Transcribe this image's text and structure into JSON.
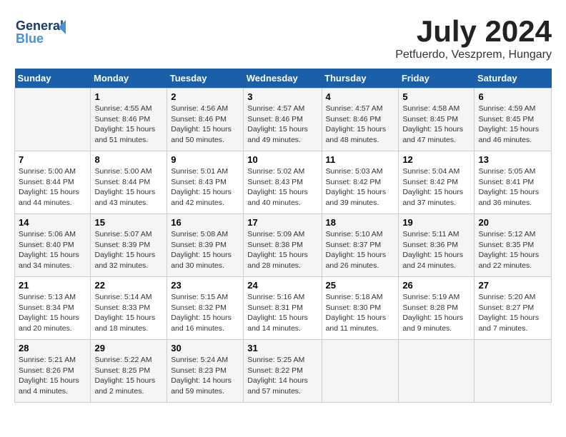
{
  "header": {
    "logo_line1": "General",
    "logo_line2": "Blue",
    "title": "July 2024",
    "location": "Petfuerdo, Veszprem, Hungary"
  },
  "calendar": {
    "days_of_week": [
      "Sunday",
      "Monday",
      "Tuesday",
      "Wednesday",
      "Thursday",
      "Friday",
      "Saturday"
    ],
    "weeks": [
      [
        {
          "day": "",
          "content": ""
        },
        {
          "day": "1",
          "content": "Sunrise: 4:55 AM\nSunset: 8:46 PM\nDaylight: 15 hours\nand 51 minutes."
        },
        {
          "day": "2",
          "content": "Sunrise: 4:56 AM\nSunset: 8:46 PM\nDaylight: 15 hours\nand 50 minutes."
        },
        {
          "day": "3",
          "content": "Sunrise: 4:57 AM\nSunset: 8:46 PM\nDaylight: 15 hours\nand 49 minutes."
        },
        {
          "day": "4",
          "content": "Sunrise: 4:57 AM\nSunset: 8:46 PM\nDaylight: 15 hours\nand 48 minutes."
        },
        {
          "day": "5",
          "content": "Sunrise: 4:58 AM\nSunset: 8:45 PM\nDaylight: 15 hours\nand 47 minutes."
        },
        {
          "day": "6",
          "content": "Sunrise: 4:59 AM\nSunset: 8:45 PM\nDaylight: 15 hours\nand 46 minutes."
        }
      ],
      [
        {
          "day": "7",
          "content": "Sunrise: 5:00 AM\nSunset: 8:44 PM\nDaylight: 15 hours\nand 44 minutes."
        },
        {
          "day": "8",
          "content": "Sunrise: 5:00 AM\nSunset: 8:44 PM\nDaylight: 15 hours\nand 43 minutes."
        },
        {
          "day": "9",
          "content": "Sunrise: 5:01 AM\nSunset: 8:43 PM\nDaylight: 15 hours\nand 42 minutes."
        },
        {
          "day": "10",
          "content": "Sunrise: 5:02 AM\nSunset: 8:43 PM\nDaylight: 15 hours\nand 40 minutes."
        },
        {
          "day": "11",
          "content": "Sunrise: 5:03 AM\nSunset: 8:42 PM\nDaylight: 15 hours\nand 39 minutes."
        },
        {
          "day": "12",
          "content": "Sunrise: 5:04 AM\nSunset: 8:42 PM\nDaylight: 15 hours\nand 37 minutes."
        },
        {
          "day": "13",
          "content": "Sunrise: 5:05 AM\nSunset: 8:41 PM\nDaylight: 15 hours\nand 36 minutes."
        }
      ],
      [
        {
          "day": "14",
          "content": "Sunrise: 5:06 AM\nSunset: 8:40 PM\nDaylight: 15 hours\nand 34 minutes."
        },
        {
          "day": "15",
          "content": "Sunrise: 5:07 AM\nSunset: 8:39 PM\nDaylight: 15 hours\nand 32 minutes."
        },
        {
          "day": "16",
          "content": "Sunrise: 5:08 AM\nSunset: 8:39 PM\nDaylight: 15 hours\nand 30 minutes."
        },
        {
          "day": "17",
          "content": "Sunrise: 5:09 AM\nSunset: 8:38 PM\nDaylight: 15 hours\nand 28 minutes."
        },
        {
          "day": "18",
          "content": "Sunrise: 5:10 AM\nSunset: 8:37 PM\nDaylight: 15 hours\nand 26 minutes."
        },
        {
          "day": "19",
          "content": "Sunrise: 5:11 AM\nSunset: 8:36 PM\nDaylight: 15 hours\nand 24 minutes."
        },
        {
          "day": "20",
          "content": "Sunrise: 5:12 AM\nSunset: 8:35 PM\nDaylight: 15 hours\nand 22 minutes."
        }
      ],
      [
        {
          "day": "21",
          "content": "Sunrise: 5:13 AM\nSunset: 8:34 PM\nDaylight: 15 hours\nand 20 minutes."
        },
        {
          "day": "22",
          "content": "Sunrise: 5:14 AM\nSunset: 8:33 PM\nDaylight: 15 hours\nand 18 minutes."
        },
        {
          "day": "23",
          "content": "Sunrise: 5:15 AM\nSunset: 8:32 PM\nDaylight: 15 hours\nand 16 minutes."
        },
        {
          "day": "24",
          "content": "Sunrise: 5:16 AM\nSunset: 8:31 PM\nDaylight: 15 hours\nand 14 minutes."
        },
        {
          "day": "25",
          "content": "Sunrise: 5:18 AM\nSunset: 8:30 PM\nDaylight: 15 hours\nand 11 minutes."
        },
        {
          "day": "26",
          "content": "Sunrise: 5:19 AM\nSunset: 8:28 PM\nDaylight: 15 hours\nand 9 minutes."
        },
        {
          "day": "27",
          "content": "Sunrise: 5:20 AM\nSunset: 8:27 PM\nDaylight: 15 hours\nand 7 minutes."
        }
      ],
      [
        {
          "day": "28",
          "content": "Sunrise: 5:21 AM\nSunset: 8:26 PM\nDaylight: 15 hours\nand 4 minutes."
        },
        {
          "day": "29",
          "content": "Sunrise: 5:22 AM\nSunset: 8:25 PM\nDaylight: 15 hours\nand 2 minutes."
        },
        {
          "day": "30",
          "content": "Sunrise: 5:24 AM\nSunset: 8:23 PM\nDaylight: 14 hours\nand 59 minutes."
        },
        {
          "day": "31",
          "content": "Sunrise: 5:25 AM\nSunset: 8:22 PM\nDaylight: 14 hours\nand 57 minutes."
        },
        {
          "day": "",
          "content": ""
        },
        {
          "day": "",
          "content": ""
        },
        {
          "day": "",
          "content": ""
        }
      ]
    ]
  }
}
